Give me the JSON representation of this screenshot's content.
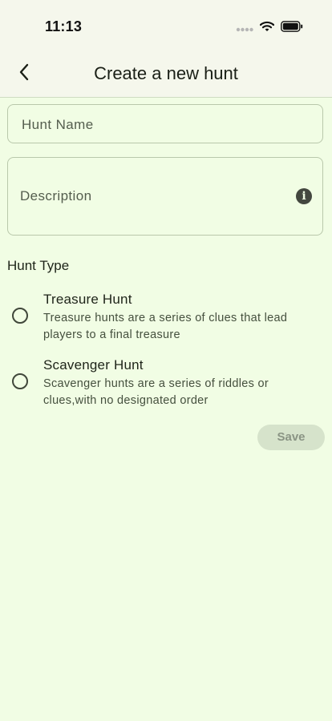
{
  "status_bar": {
    "time": "11:13",
    "icons": [
      "cellular-dots-icon",
      "wifi-icon",
      "battery-icon"
    ]
  },
  "header": {
    "back_icon": "chevron-left-icon",
    "title": "Create a new hunt"
  },
  "form": {
    "hunt_name_placeholder": "Hunt Name",
    "hunt_name_value": "",
    "description_placeholder": "Description",
    "description_value": "",
    "description_info_icon": "info-icon"
  },
  "hunt_type": {
    "label": "Hunt Type",
    "options": [
      {
        "title": "Treasure Hunt",
        "description": "Treasure hunts are a series of clues that lead players to a final treasure",
        "selected": false
      },
      {
        "title": "Scavenger Hunt",
        "description": "Scavenger hunts are a series of riddles or clues,with no designated order",
        "selected": false
      }
    ]
  },
  "actions": {
    "save_label": "Save",
    "save_enabled": false
  },
  "colors": {
    "background": "#f1fde4",
    "app_bar": "#f5f7ec",
    "border": "#b9c8ab",
    "save_disabled_bg": "#d6e3cb",
    "save_disabled_text": "#8a9484"
  }
}
